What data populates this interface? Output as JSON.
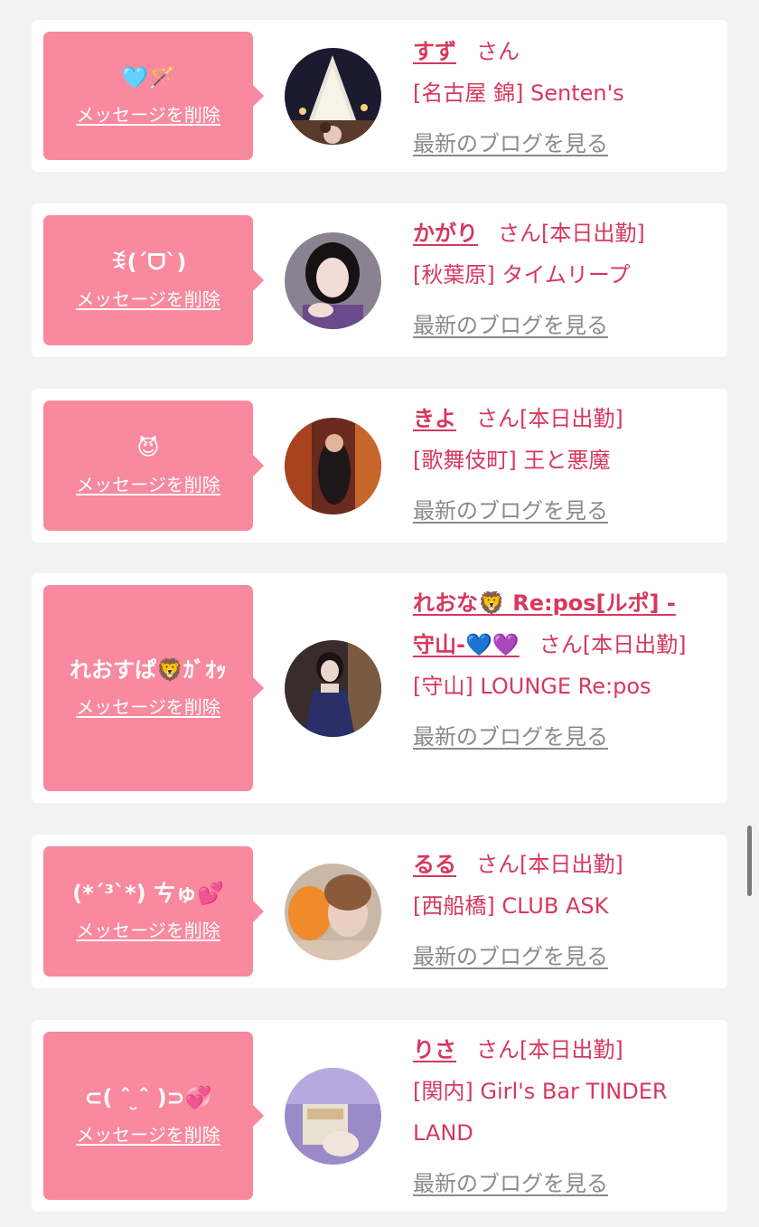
{
  "colors": {
    "bubble": "#f8899e",
    "accent_text": "#d7385e",
    "link_gray": "#8a8a8a",
    "page_bg": "#f2f2f2"
  },
  "delete_label": "メッセージを削除",
  "blog_label": "最新のブログを見る",
  "entries": [
    {
      "message": "🩵🪄",
      "name": "すず",
      "honorific": "さん",
      "status": "",
      "shop": "[名古屋 錦] Senten's",
      "avatar_icon": "photo-christmas-tree"
    },
    {
      "message": "ꉂ(ˊᗜˋ)",
      "name": "かがり",
      "honorific": "さん",
      "status": "[本日出勤]",
      "shop": "[秋葉原] タイムリープ",
      "avatar_icon": "photo-girl-portrait"
    },
    {
      "message": "😈",
      "name": "きよ",
      "honorific": "さん",
      "status": "[本日出勤]",
      "shop": "[歌舞伎町] 王と悪魔",
      "avatar_icon": "photo-interior"
    },
    {
      "message": "れおすぱ🦁ｶﾞｵｯ",
      "name": "れおな🦁 Re:pos[ルポ] - 守山-💙💜",
      "honorific": "さん",
      "status": "[本日出勤]",
      "shop": "[守山] LOUNGE Re:pos",
      "avatar_icon": "photo-dress-portrait"
    },
    {
      "message": "(*´³`*) ㄘゅ💕",
      "name": "るる",
      "honorific": "さん",
      "status": "[本日出勤]",
      "shop": "[西船橋] CLUB ASK",
      "avatar_icon": "photo-dessert-selfie"
    },
    {
      "message": "⊂( ˆ ̮ˆ )⊃💞",
      "name": "りさ",
      "honorific": "さん",
      "status": "[本日出勤]",
      "shop": "[関内] Girl's Bar TINDER LAND",
      "avatar_icon": "photo-purple-room"
    }
  ]
}
